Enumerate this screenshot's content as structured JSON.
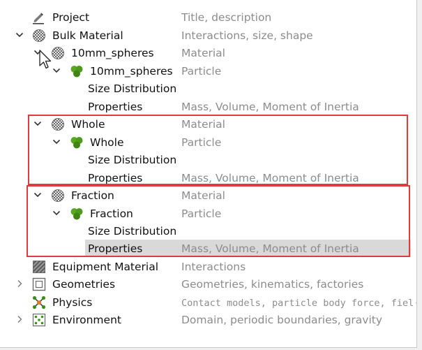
{
  "tree": {
    "project": {
      "label": "Project",
      "desc": "Title, description"
    },
    "bulk_material": {
      "label": "Bulk Material",
      "desc": "Interactions, size, shape"
    },
    "mat_10mm": {
      "label": "10mm_spheres",
      "desc": "Material"
    },
    "part_10mm": {
      "label": "10mm_spheres",
      "desc": "Particle"
    },
    "sizedist_10mm": {
      "label": "Size Distribution",
      "desc": ""
    },
    "props_10mm": {
      "label": "Properties",
      "desc": "Mass, Volume, Moment of Inertia"
    },
    "mat_whole": {
      "label": "Whole",
      "desc": "Material"
    },
    "part_whole": {
      "label": "Whole",
      "desc": "Particle"
    },
    "sizedist_whole": {
      "label": "Size Distribution",
      "desc": ""
    },
    "props_whole": {
      "label": "Properties",
      "desc": "Mass, Volume, Moment of Inertia"
    },
    "mat_fraction": {
      "label": "Fraction",
      "desc": "Material"
    },
    "part_fraction": {
      "label": "Fraction",
      "desc": "Particle"
    },
    "sizedist_fraction": {
      "label": "Size Distribution",
      "desc": ""
    },
    "props_fraction": {
      "label": "Properties",
      "desc": "Mass, Volume, Moment of Inertia"
    },
    "equipment_material": {
      "label": "Equipment Material",
      "desc": "Interactions"
    },
    "geometries": {
      "label": "Geometries",
      "desc": "Geometries, kinematics, factories"
    },
    "physics": {
      "label": "Physics",
      "desc": "Contact models, particle body force, fiel··"
    },
    "environment": {
      "label": "Environment",
      "desc": "Domain, periodic boundaries, gravity"
    }
  },
  "icons": {
    "project": "pencil-icon",
    "bulk_material": "checkered-sphere-icon",
    "material": "checkered-sphere-icon",
    "particle": "green-clover-icon",
    "equipment_material": "hatched-square-icon",
    "geometries": "square-frame-icon",
    "physics": "molecule-icon",
    "environment": "environment-grid-icon"
  },
  "colors": {
    "highlight_border": "#e23a3a",
    "selected_row": "#d9d9d9",
    "description_text": "#8c8c8c",
    "particle_green": "#4e9a1c"
  }
}
